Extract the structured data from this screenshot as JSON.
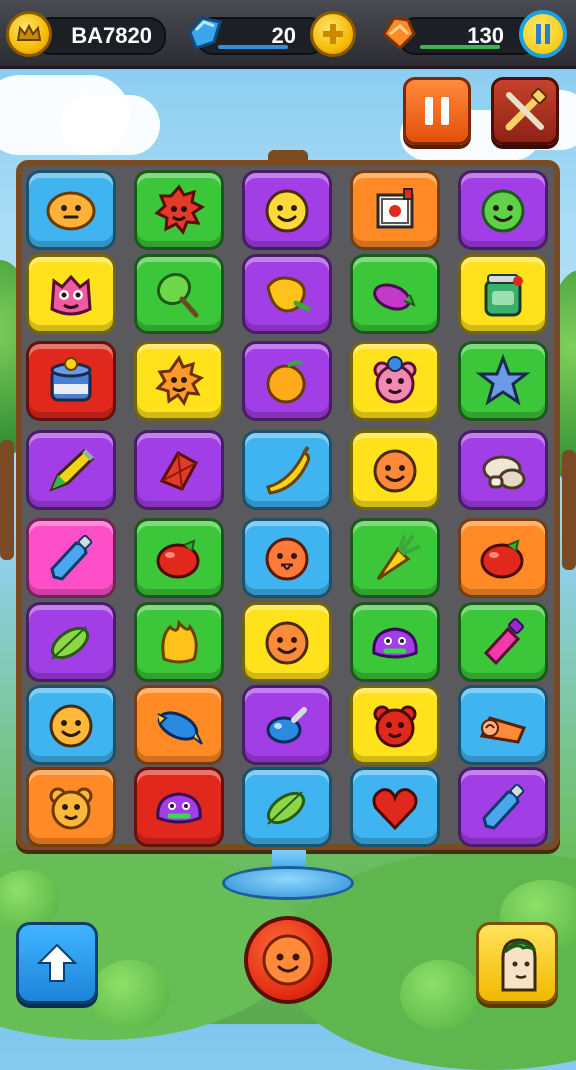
{
  "top_bar": {
    "player_id": "BA7820",
    "crystals": "20",
    "gems": "130"
  },
  "colors": {
    "blue": "#3fb4f0",
    "green": "#3cc63a",
    "purple": "#a23ee6",
    "orange": "#ff8a26",
    "yellow": "#ffe21c",
    "red": "#e0281c",
    "pink": "#ff4fc8",
    "board": "#5a5a5e"
  },
  "board": {
    "rows": [
      [
        {
          "color": "blue",
          "icon": "smiley-blob-icon"
        },
        {
          "color": "green",
          "icon": "red-spiky-monster-icon"
        },
        {
          "color": "purple",
          "icon": "smiley-face-icon"
        },
        {
          "color": "orange",
          "icon": "box-icon"
        },
        {
          "color": "purple",
          "icon": "green-face-icon"
        }
      ],
      [
        {
          "color": "yellow",
          "icon": "pink-monster-icon"
        },
        {
          "color": "green",
          "icon": "green-lollipop-icon"
        },
        {
          "color": "purple",
          "icon": "yellow-fruit-icon"
        },
        {
          "color": "green",
          "icon": "eggplant-icon"
        },
        {
          "color": "yellow",
          "icon": "green-jar-icon"
        }
      ],
      [
        {
          "color": "red",
          "icon": "cake-tin-icon"
        },
        {
          "color": "yellow",
          "icon": "orange-sun-icon"
        },
        {
          "color": "purple",
          "icon": "orange-fruit-icon"
        },
        {
          "color": "yellow",
          "icon": "pink-bear-icon"
        },
        {
          "color": "green",
          "icon": "star-icon"
        }
      ],
      [
        {
          "color": "purple",
          "icon": "pencil-icon"
        },
        {
          "color": "purple",
          "icon": "red-kite-icon"
        },
        {
          "color": "blue",
          "icon": "banana-icon"
        },
        {
          "color": "yellow",
          "icon": "orange-face-icon"
        },
        {
          "color": "purple",
          "icon": "mushroom-icon"
        }
      ],
      [
        {
          "color": "pink",
          "icon": "blue-bottle-icon"
        },
        {
          "color": "green",
          "icon": "tomato-icon"
        },
        {
          "color": "blue",
          "icon": "orange-tongue-face-icon"
        },
        {
          "color": "green",
          "icon": "carrot-icon"
        },
        {
          "color": "orange",
          "icon": "tomato-icon"
        }
      ],
      [
        {
          "color": "purple",
          "icon": "green-leaf-icon"
        },
        {
          "color": "green",
          "icon": "yellow-bud-icon"
        },
        {
          "color": "yellow",
          "icon": "orange-face-icon"
        },
        {
          "color": "green",
          "icon": "purple-blob-icon"
        },
        {
          "color": "green",
          "icon": "pink-bottle-icon"
        }
      ],
      [
        {
          "color": "blue",
          "icon": "yellow-face-icon"
        },
        {
          "color": "orange",
          "icon": "blue-fish-icon"
        },
        {
          "color": "purple",
          "icon": "blue-drop-icon"
        },
        {
          "color": "yellow",
          "icon": "red-bear-icon"
        },
        {
          "color": "blue",
          "icon": "carrot-roll-icon"
        }
      ],
      [
        {
          "color": "orange",
          "icon": "bear-face-icon"
        },
        {
          "color": "red",
          "icon": "purple-blob-icon"
        },
        {
          "color": "blue",
          "icon": "green-leaf-icon"
        },
        {
          "color": "blue",
          "icon": "heart-icon"
        },
        {
          "color": "purple",
          "icon": "blue-bottle-icon"
        }
      ]
    ]
  }
}
